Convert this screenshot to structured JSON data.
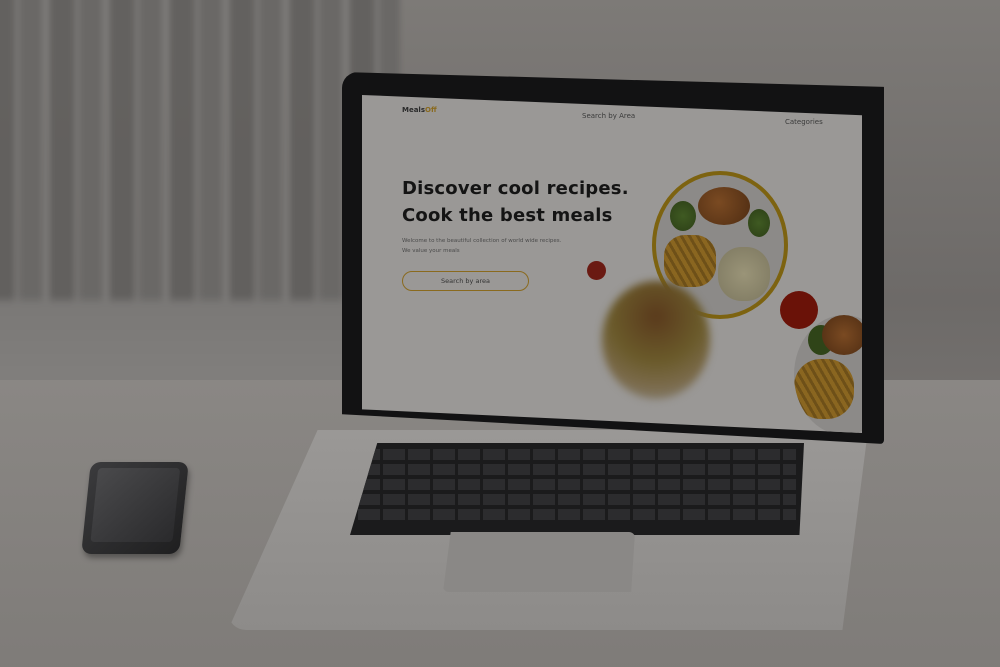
{
  "nav": {
    "logo_prefix": "Meals",
    "logo_accent": "Off",
    "search_area": "Search by Area",
    "categories": "Categories"
  },
  "hero": {
    "headline_line1": "Discover cool recipes.",
    "headline_line2": "Cook the best meals",
    "subtext_line1": "Welcome to the beautiful collection of world wide recipes.",
    "subtext_line2": "We value your meals",
    "cta_label": "Search by area"
  },
  "colors": {
    "accent": "#c9a227",
    "tomato": "#c8230f",
    "background": "#f5f5f2"
  },
  "icons": [
    "phone-icon"
  ]
}
